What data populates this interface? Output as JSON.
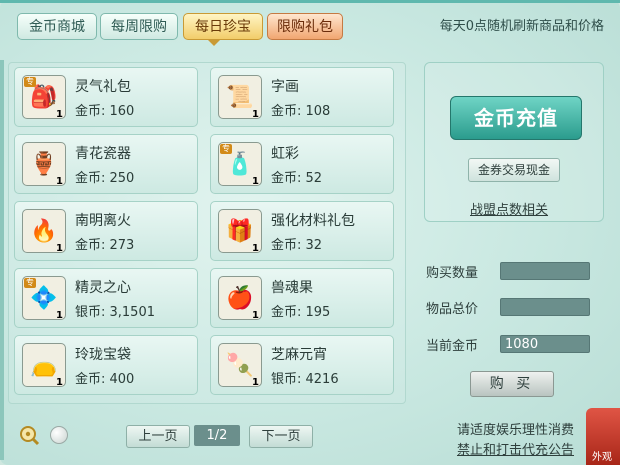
{
  "tabs": [
    {
      "label": "金币商城"
    },
    {
      "label": "每周限购"
    },
    {
      "label": "每日珍宝"
    },
    {
      "label": "限购礼包"
    }
  ],
  "refresh_note": "每天0点随机刷新商品和价格",
  "items": [
    {
      "name": "灵气礼包",
      "price": "金币: 160",
      "qty": "1",
      "tag": "专",
      "icon": "gift-bag-icon",
      "glyph": "🎒"
    },
    {
      "name": "字画",
      "price": "金币: 108",
      "qty": "1",
      "tag": "",
      "icon": "scroll-icon",
      "glyph": "📜"
    },
    {
      "name": "青花瓷器",
      "price": "金币: 250",
      "qty": "1",
      "tag": "",
      "icon": "porcelain-vase-icon",
      "glyph": "🏺"
    },
    {
      "name": "虹彩",
      "price": "金币: 52",
      "qty": "1",
      "tag": "专",
      "icon": "rainbow-bottle-icon",
      "glyph": "🧴"
    },
    {
      "name": "南明离火",
      "price": "金币: 273",
      "qty": "1",
      "tag": "",
      "icon": "fire-ring-icon",
      "glyph": "🔥"
    },
    {
      "name": "强化材料礼包",
      "price": "金币: 32",
      "qty": "1",
      "tag": "",
      "icon": "material-bag-icon",
      "glyph": "🎁"
    },
    {
      "name": "精灵之心",
      "price": "银币: 3,1501",
      "qty": "1",
      "tag": "专",
      "icon": "spirit-heart-icon",
      "glyph": "💠"
    },
    {
      "name": "兽魂果",
      "price": "金币: 195",
      "qty": "1",
      "tag": "",
      "icon": "beast-fruit-icon",
      "glyph": "🍎"
    },
    {
      "name": "玲珑宝袋",
      "price": "金币: 400",
      "qty": "1",
      "tag": "",
      "icon": "treasure-bag-icon",
      "glyph": "👝"
    },
    {
      "name": "芝麻元宵",
      "price": "银币: 4216",
      "qty": "1",
      "tag": "",
      "icon": "rice-balls-icon",
      "glyph": "🍡"
    }
  ],
  "recharge_label": "金币充值",
  "exchange_label": "金券交易现金",
  "alliance_label": "战盟点数相关",
  "fields": {
    "qty_label": "购买数量",
    "qty_value": "",
    "total_label": "物品总价",
    "total_value": "",
    "coins_label": "当前金币",
    "coins_value": "1080"
  },
  "buy_label": "购 买",
  "pager": {
    "prev_label": "上一页",
    "page": "1/2",
    "next_label": "下一页"
  },
  "notices": {
    "line1": "请适度娱乐理性消费",
    "line2": "禁止和打击代充公告"
  },
  "corner_text": "外观"
}
